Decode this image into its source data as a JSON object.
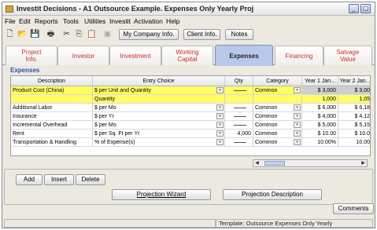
{
  "window": {
    "title": "Investit Decisions  - A1 Outsource Example. Expenses Only Yearly Proj"
  },
  "menu": [
    "File",
    "Edit",
    "Reports",
    "Tools",
    "Utilities",
    "Investit",
    "Activation",
    "Help"
  ],
  "toolbar": {
    "my_company": "My Company Info.",
    "client": "Client Info.",
    "notes": "Notes"
  },
  "tabs": [
    {
      "label": "Project Info."
    },
    {
      "label": "Investor"
    },
    {
      "label": "Investment"
    },
    {
      "label": "Working Capital"
    },
    {
      "label": "Expenses"
    },
    {
      "label": "Financing"
    },
    {
      "label": "Salvage Value"
    }
  ],
  "section_title": "Expenses",
  "columns": [
    "Description",
    "Entry Choice",
    "Qty",
    "Category",
    "Year 1 Jan...",
    "Year 2 Jan..."
  ],
  "rows": [
    {
      "description": "Product Cost (China)",
      "entry": "$ per Unit and Quantity",
      "qty": "",
      "category": "Common",
      "y1": "$ 3,000",
      "y2": "$ 3,00"
    },
    {
      "description": "",
      "entry": "Quantity",
      "qty": "",
      "category": "",
      "y1": "1,000",
      "y2": "1,05"
    },
    {
      "description": "Additional Labor",
      "entry": "$ per Mo",
      "qty": "",
      "category": "Common",
      "y1": "$ 6,000",
      "y2": "$ 6,18"
    },
    {
      "description": "Insurance",
      "entry": "$ per Yr",
      "qty": "",
      "category": "Common",
      "y1": "$ 4,000",
      "y2": "$ 4,12"
    },
    {
      "description": "Incremental Overhead",
      "entry": "$ per Mo",
      "qty": "",
      "category": "Common",
      "y1": "$ 5,000",
      "y2": "$ 5,15"
    },
    {
      "description": "Rent",
      "entry": "$ per Sq. Ft per Yr",
      "qty": "4,000",
      "category": "Common",
      "y1": "$ 10.00",
      "y2": "$ 10.0"
    },
    {
      "description": "Transportation & Handling",
      "entry": "% of Expense(s)",
      "qty": "",
      "category": "Common",
      "y1": "10.00%",
      "y2": "10.00"
    }
  ],
  "buttons": {
    "add": "Add",
    "insert": "Insert",
    "delete": "Delete",
    "wizard": "Projection Wizard",
    "description": "Projection Description",
    "comments": "Comments"
  },
  "status": {
    "template": "Template: Outsource Expenses Only Yearly"
  }
}
